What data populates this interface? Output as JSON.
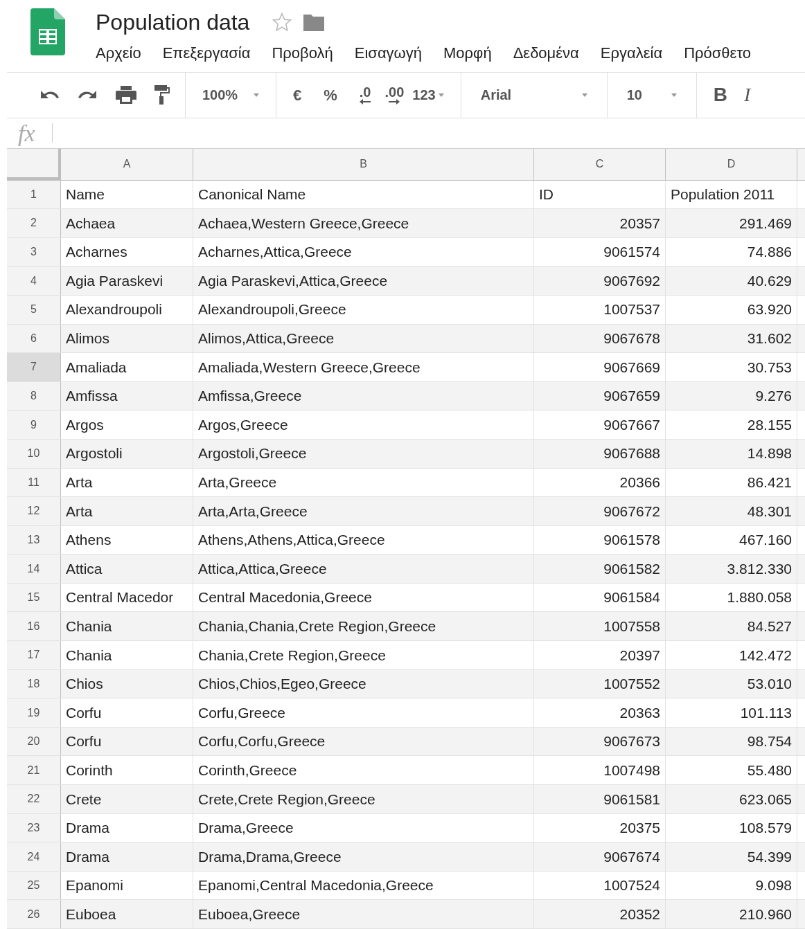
{
  "document": {
    "title": "Population data",
    "starred": false
  },
  "menu": [
    "Αρχείο",
    "Επεξεργασία",
    "Προβολή",
    "Εισαγωγή",
    "Μορφή",
    "Δεδομένα",
    "Εργαλεία",
    "Πρόσθετο"
  ],
  "toolbar": {
    "zoom": "100%",
    "currency": "€",
    "percent": "%",
    "decrease_decimals": ".0",
    "increase_decimals": ".00",
    "number_format": "123",
    "font": "Arial",
    "font_size": "10",
    "bold": "B",
    "italic": "I"
  },
  "formula_bar": {
    "label": "fx"
  },
  "columns": [
    "A",
    "B",
    "C",
    "D"
  ],
  "rows": [
    {
      "number": "1",
      "selected": false,
      "cells": [
        "Name",
        "Canonical Name",
        "ID",
        "Population 2011"
      ]
    },
    {
      "number": "2",
      "selected": false,
      "cells": [
        "Achaea",
        "Achaea,Western Greece,Greece",
        "20357",
        "291.469"
      ]
    },
    {
      "number": "3",
      "selected": false,
      "cells": [
        "Acharnes",
        "Acharnes,Attica,Greece",
        "9061574",
        "74.886"
      ]
    },
    {
      "number": "4",
      "selected": false,
      "cells": [
        "Agia Paraskevi",
        "Agia Paraskevi,Attica,Greece",
        "9067692",
        "40.629"
      ]
    },
    {
      "number": "5",
      "selected": false,
      "cells": [
        "Alexandroupoli",
        "Alexandroupoli,Greece",
        "1007537",
        "63.920"
      ]
    },
    {
      "number": "6",
      "selected": false,
      "cells": [
        "Alimos",
        "Alimos,Attica,Greece",
        "9067678",
        "31.602"
      ]
    },
    {
      "number": "7",
      "selected": true,
      "cells": [
        "Amaliada",
        "Amaliada,Western Greece,Greece",
        "9067669",
        "30.753"
      ]
    },
    {
      "number": "8",
      "selected": false,
      "cells": [
        "Amfissa",
        "Amfissa,Greece",
        "9067659",
        "9.276"
      ]
    },
    {
      "number": "9",
      "selected": false,
      "cells": [
        "Argos",
        "Argos,Greece",
        "9067667",
        "28.155"
      ]
    },
    {
      "number": "10",
      "selected": false,
      "cells": [
        "Argostoli",
        "Argostoli,Greece",
        "9067688",
        "14.898"
      ]
    },
    {
      "number": "11",
      "selected": false,
      "cells": [
        "Arta",
        "Arta,Greece",
        "20366",
        "86.421"
      ]
    },
    {
      "number": "12",
      "selected": false,
      "cells": [
        "Arta",
        "Arta,Arta,Greece",
        "9067672",
        "48.301"
      ]
    },
    {
      "number": "13",
      "selected": false,
      "cells": [
        "Athens",
        "Athens,Athens,Attica,Greece",
        "9061578",
        "467.160"
      ]
    },
    {
      "number": "14",
      "selected": false,
      "cells": [
        "Attica",
        "Attica,Attica,Greece",
        "9061582",
        "3.812.330"
      ]
    },
    {
      "number": "15",
      "selected": false,
      "cells": [
        "Central Macedor",
        "Central Macedonia,Greece",
        "9061584",
        "1.880.058"
      ]
    },
    {
      "number": "16",
      "selected": false,
      "cells": [
        "Chania",
        "Chania,Chania,Crete Region,Greece",
        "1007558",
        "84.527"
      ]
    },
    {
      "number": "17",
      "selected": false,
      "cells": [
        "Chania",
        "Chania,Crete Region,Greece",
        "20397",
        "142.472"
      ]
    },
    {
      "number": "18",
      "selected": false,
      "cells": [
        "Chios",
        "Chios,Chios,Egeo,Greece",
        "1007552",
        "53.010"
      ]
    },
    {
      "number": "19",
      "selected": false,
      "cells": [
        "Corfu",
        "Corfu,Greece",
        "20363",
        "101.113"
      ]
    },
    {
      "number": "20",
      "selected": false,
      "cells": [
        "Corfu",
        "Corfu,Corfu,Greece",
        "9067673",
        "98.754"
      ]
    },
    {
      "number": "21",
      "selected": false,
      "cells": [
        "Corinth",
        "Corinth,Greece",
        "1007498",
        "55.480"
      ]
    },
    {
      "number": "22",
      "selected": false,
      "cells": [
        "Crete",
        "Crete,Crete Region,Greece",
        "9061581",
        "623.065"
      ]
    },
    {
      "number": "23",
      "selected": false,
      "cells": [
        "Drama",
        "Drama,Greece",
        "20375",
        "108.579"
      ]
    },
    {
      "number": "24",
      "selected": false,
      "cells": [
        "Drama",
        "Drama,Drama,Greece",
        "9067674",
        "54.399"
      ]
    },
    {
      "number": "25",
      "selected": false,
      "cells": [
        "Epanomi",
        "Epanomi,Central Macedonia,Greece",
        "1007524",
        "9.098"
      ]
    },
    {
      "number": "26",
      "selected": false,
      "cells": [
        "Euboea",
        "Euboea,Greece",
        "20352",
        "210.960"
      ]
    }
  ]
}
